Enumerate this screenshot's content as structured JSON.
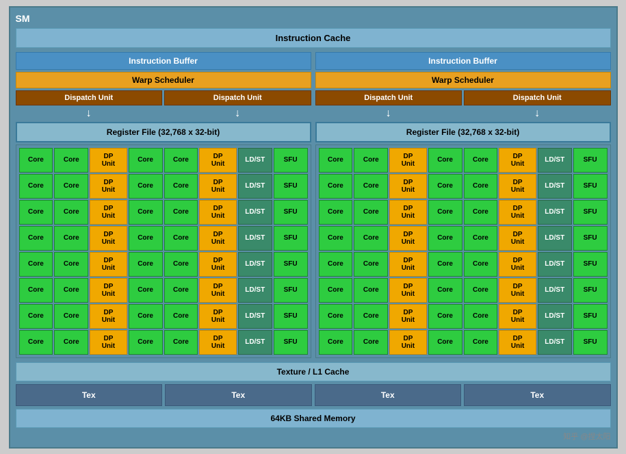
{
  "sm": {
    "label": "SM",
    "instruction_cache": "Instruction Cache",
    "left": {
      "instruction_buffer": "Instruction Buffer",
      "warp_scheduler": "Warp Scheduler",
      "dispatch_unit_1": "Dispatch Unit",
      "dispatch_unit_2": "Dispatch Unit",
      "register_file": "Register File (32,768 x 32-bit)"
    },
    "right": {
      "instruction_buffer": "Instruction Buffer",
      "warp_scheduler": "Warp Scheduler",
      "dispatch_unit_1": "Dispatch Unit",
      "dispatch_unit_2": "Dispatch Unit",
      "register_file": "Register File (32,768 x 32-bit)"
    },
    "cells": {
      "core": "Core",
      "dp_unit": "DP\nUnit",
      "ldst": "LD/ST",
      "sfu": "SFU"
    },
    "texture_cache": "Texture / L1 Cache",
    "tex": "Tex",
    "shared_memory": "64KB Shared Memory",
    "watermark": "知乎 @捏太阳"
  }
}
